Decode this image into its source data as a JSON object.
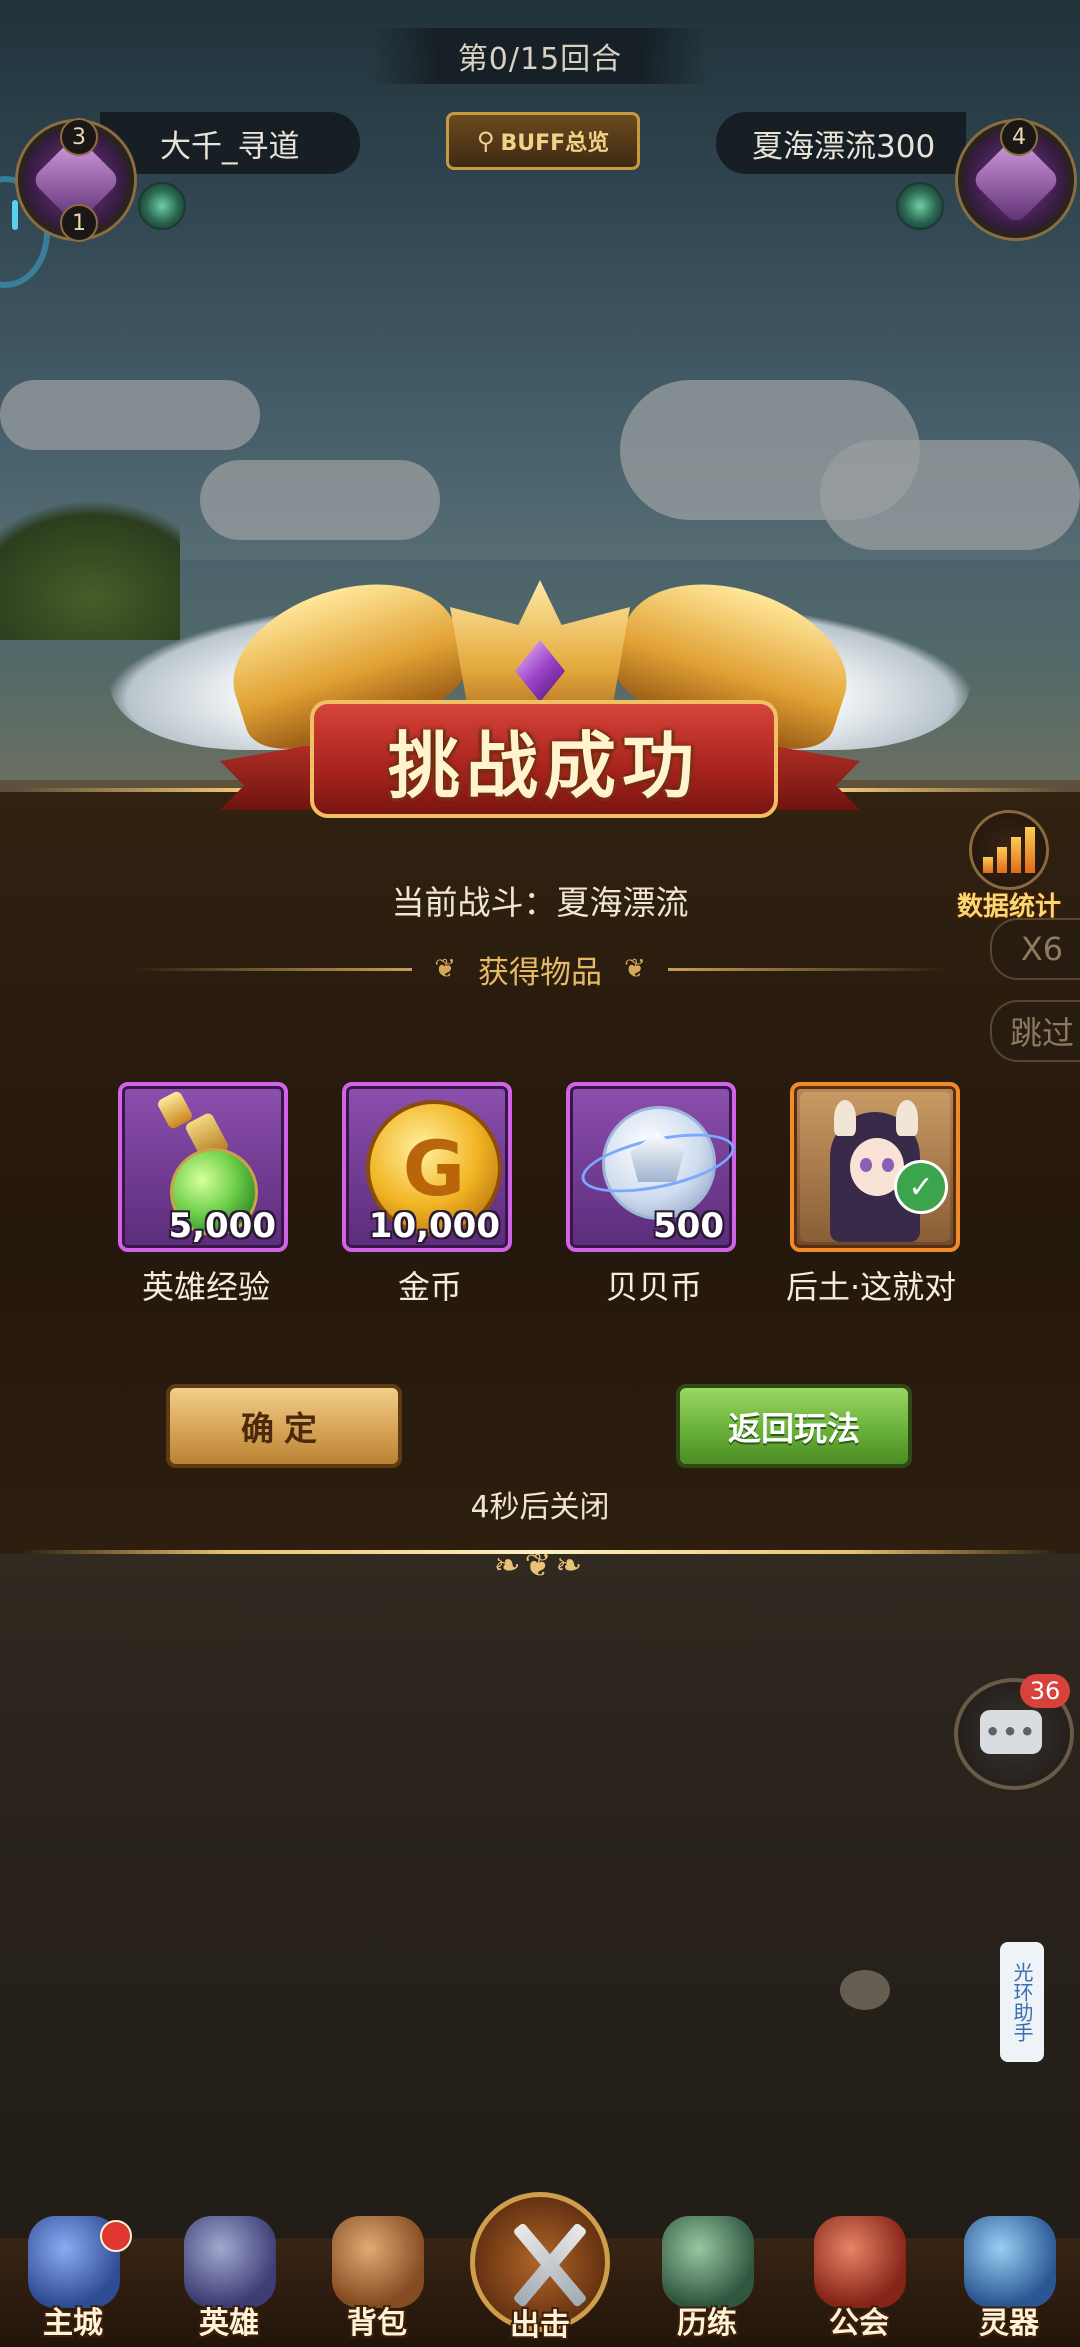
{
  "hud": {
    "round": "第0/15回合",
    "buff_button": "BUFF总览",
    "player_left": {
      "name": "大千_寻道",
      "level_top": "3",
      "level_bottom": "1"
    },
    "player_right": {
      "name": "夏海漂流300",
      "level_top": "4"
    }
  },
  "result": {
    "title": "挑战成功",
    "battle_label": "当前战斗：夏海漂流",
    "items_header": "获得物品",
    "items": [
      {
        "name": "英雄经验",
        "qty": "5,000",
        "icon": "exp-potion-icon"
      },
      {
        "name": "金币",
        "qty": "10,000",
        "icon": "gold-coin-icon"
      },
      {
        "name": "贝贝币",
        "qty": "500",
        "icon": "shell-coin-icon"
      },
      {
        "name": "后土·这就对",
        "qty": "",
        "icon": "hero-portrait-icon"
      }
    ],
    "confirm_button": "确定",
    "back_button": "返回玩法",
    "close_timer": "4秒后关闭"
  },
  "side": {
    "stats_label": "数据统计",
    "speed_label": "X6",
    "skip_label": "跳过",
    "chat_count": "36",
    "assistant_label": "光环助手"
  },
  "nav": {
    "items": [
      {
        "label": "主城"
      },
      {
        "label": "英雄"
      },
      {
        "label": "背包"
      },
      {
        "label": "出击"
      },
      {
        "label": "历练"
      },
      {
        "label": "公会"
      },
      {
        "label": "灵器"
      }
    ]
  },
  "colors": {
    "panel_bg": "#2d1e0e",
    "accent_gold": "#e9c170",
    "confirm_button": "#d7a456",
    "back_button": "#69b13a",
    "item_frame_purple": "#d163e6",
    "item_frame_orange": "#f08b2c",
    "badge_red": "#d8423c"
  }
}
